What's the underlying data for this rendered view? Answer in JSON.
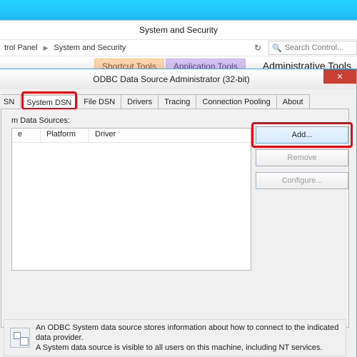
{
  "explorer": {
    "title": "System and Security",
    "breadcrumb": {
      "item0": "trol Panel",
      "item1": "System and Security"
    },
    "search_placeholder": "Search Control...",
    "ribbon": {
      "shortcut": "Shortcut Tools",
      "application": "Application Tools",
      "right_title": "Administrative Tools"
    }
  },
  "dialog": {
    "title": "ODBC Data Source Administrator (32-bit)",
    "close": "✕",
    "tabs": {
      "t0": "SN",
      "t1": "System DSN",
      "t2": "File DSN",
      "t3": "Drivers",
      "t4": "Tracing",
      "t5": "Connection Pooling",
      "t6": "About"
    },
    "ds_label": "m Data Sources:",
    "columns": {
      "c0": "e",
      "c1": "Platform",
      "c2": "Driver"
    },
    "buttons": {
      "add": "Add...",
      "remove": "Remove",
      "configure": "Configure..."
    },
    "info_line1": "An ODBC System data source stores information about how to connect to the indicated data provider.",
    "info_line2": "A System data source is visible to all users on this machine, including NT services."
  }
}
